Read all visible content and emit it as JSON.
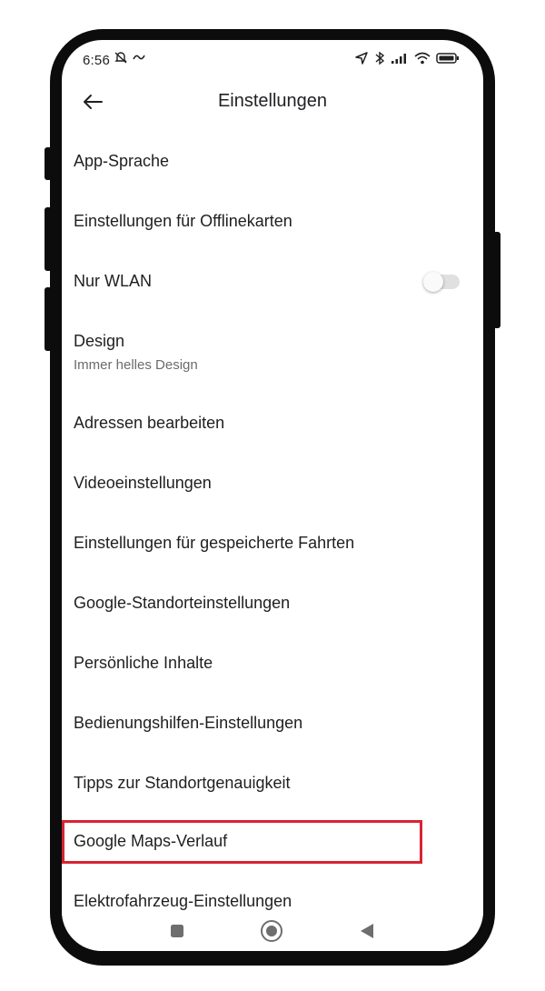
{
  "statusbar": {
    "time": "6:56",
    "left_icons": [
      "muted-notification-icon",
      "nfc-icon"
    ],
    "right_icons": [
      "location-arrow-icon",
      "bluetooth-icon",
      "signal-icon",
      "wifi-icon",
      "battery-icon"
    ]
  },
  "appbar": {
    "back_icon": "arrow-left-icon",
    "title": "Einstellungen"
  },
  "settings": {
    "items": [
      {
        "label": "App-Sprache"
      },
      {
        "label": "Einstellungen für Offlinekarten"
      },
      {
        "label": "Nur WLAN",
        "toggle": false
      },
      {
        "label": "Design",
        "subtitle": "Immer helles Design"
      },
      {
        "label": "Adressen bearbeiten"
      },
      {
        "label": "Videoeinstellungen"
      },
      {
        "label": "Einstellungen für gespeicherte Fahrten"
      },
      {
        "label": "Google-Standorteinstellungen"
      },
      {
        "label": "Persönliche Inhalte"
      },
      {
        "label": "Bedienungshilfen-Einstellungen"
      },
      {
        "label": "Tipps zur Standortgenauigkeit"
      },
      {
        "label": "Google Maps-Verlauf",
        "highlighted": true
      },
      {
        "label": "Elektrofahrzeug-Einstellungen"
      }
    ]
  },
  "navbar": {
    "icons": [
      "recents-square-icon",
      "home-circle-icon",
      "back-triangle-icon"
    ]
  },
  "colors": {
    "highlight_border": "#d62433",
    "frame": "#0c0c0c",
    "text": "#1f1f1f",
    "subtext": "#6b6b6b"
  }
}
